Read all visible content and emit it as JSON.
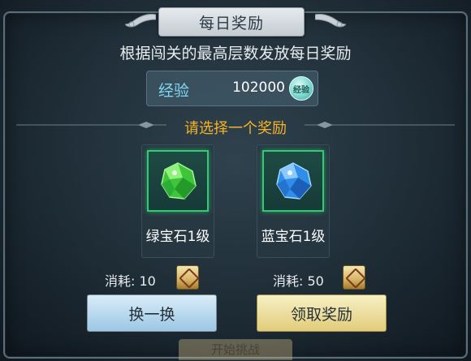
{
  "dialog": {
    "title": "每日奖励",
    "subtitle": "根据闯关的最高层数发放每日奖励"
  },
  "experience": {
    "label": "经验",
    "value": "102000",
    "icon_text": "经验"
  },
  "prompt": "请选择一个奖励",
  "rewards": [
    {
      "name": "绿宝石1级",
      "gem_color": "#3fc43a",
      "icon": "green-gem-icon"
    },
    {
      "name": "蓝宝石1级",
      "gem_color": "#2f8ee8",
      "icon": "blue-gem-icon"
    }
  ],
  "costs": [
    {
      "label": "消耗:",
      "value": "10"
    },
    {
      "label": "消耗:",
      "value": "50"
    }
  ],
  "buttons": {
    "swap": "换一换",
    "claim": "领取奖励"
  },
  "background": {
    "bottom_text": "开始挑战"
  },
  "colors": {
    "accent_gold": "#f5b324",
    "exp_label": "#7fd6f2",
    "slot_border": "#2fcc72"
  }
}
